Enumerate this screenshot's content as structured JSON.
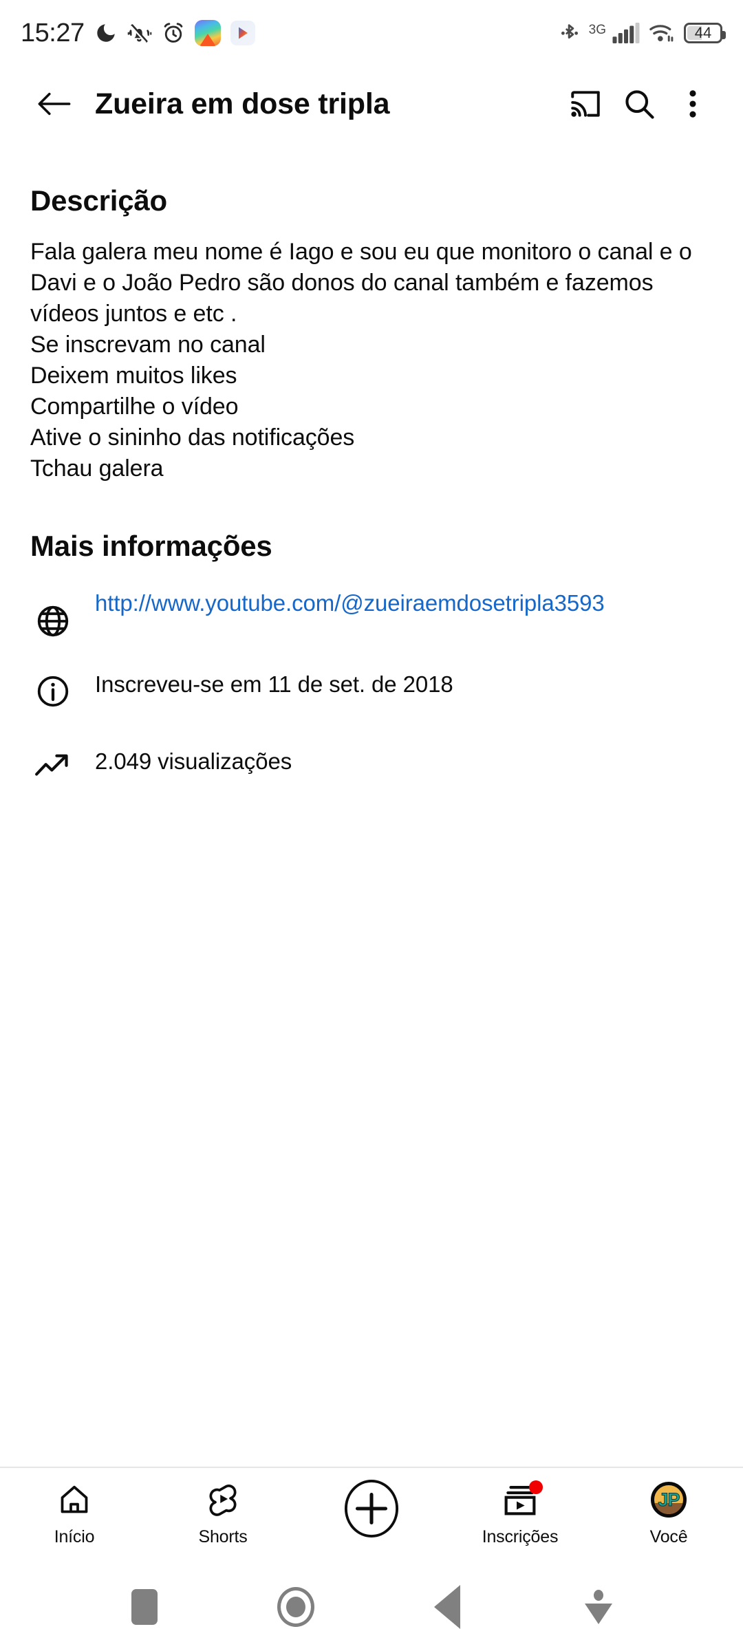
{
  "status_bar": {
    "time": "15:27",
    "network_type": "3G",
    "battery_level": "44",
    "icons": [
      "do-not-disturb-moon-icon",
      "mute-vibrate-icon",
      "alarm-clock-icon",
      "rainbow-app-icon",
      "play-app-icon",
      "bluetooth-icon",
      "cellular-signal-icon",
      "wifi-icon",
      "battery-icon"
    ]
  },
  "app_bar": {
    "back_label": "back-arrow",
    "title": "Zueira em dose tripla",
    "cast_label": "cast",
    "search_label": "search",
    "overflow_label": "more options"
  },
  "description": {
    "heading": "Descrição",
    "body": "Fala galera meu nome é Iago e sou eu que monitoro o canal e o Davi e o João Pedro são donos do canal também e fazemos vídeos juntos e etc .\nSe inscrevam no canal\nDeixem muitos likes\nCompartilhe o vídeo\nAtive o sininho das notificações\nTchau galera"
  },
  "more_info": {
    "heading": "Mais informações",
    "rows": [
      {
        "icon": "globe-icon",
        "text": "http://www.youtube.com/@zueiraemdosetripla3593",
        "is_link": true
      },
      {
        "icon": "info-circle-icon",
        "text": "Inscreveu-se em 11 de set. de 2018",
        "is_link": false
      },
      {
        "icon": "trending-up-icon",
        "text": "2.049 visualizações",
        "is_link": false
      }
    ]
  },
  "bottom_nav": {
    "items": [
      {
        "label": "Início",
        "icon": "home-icon",
        "badge": false
      },
      {
        "label": "Shorts",
        "icon": "shorts-icon",
        "badge": false
      },
      {
        "label": "",
        "icon": "create-plus-icon",
        "badge": false
      },
      {
        "label": "Inscrições",
        "icon": "subscriptions-icon",
        "badge": true
      },
      {
        "label": "Você",
        "icon": "account-avatar-icon",
        "badge": false
      }
    ]
  },
  "android_nav": {
    "recents_label": "recents",
    "home_label": "home",
    "back_label": "back",
    "dismiss_label": "dismiss"
  },
  "colors": {
    "link": "#1667c8",
    "badge": "#f00000",
    "text": "#0d0d0d",
    "divider": "#e6e6e6"
  },
  "avatar": {
    "initials": "JP"
  }
}
